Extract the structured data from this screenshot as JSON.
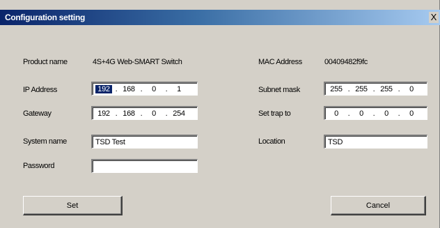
{
  "window": {
    "title": "Configuration setting",
    "close_glyph": "X"
  },
  "left": {
    "product_name_label": "Product name",
    "product_name_value": "4S+4G Web-SMART Switch",
    "ip_label": "IP Address",
    "ip": [
      "192",
      "168",
      "0",
      "1"
    ],
    "gateway_label": "Gateway",
    "gateway": [
      "192",
      "168",
      "0",
      "254"
    ],
    "system_name_label": "System name",
    "system_name": "TSD Test",
    "password_label": "Password",
    "password": ""
  },
  "right": {
    "mac_label": "MAC Address",
    "mac_value": "00409482f9fc",
    "subnet_label": "Subnet mask",
    "subnet": [
      "255",
      "255",
      "255",
      "0"
    ],
    "trap_label": "Set trap to",
    "trap": [
      "0",
      "0",
      "0",
      "0"
    ],
    "location_label": "Location",
    "location": "TSD"
  },
  "buttons": {
    "set": "Set",
    "cancel": "Cancel"
  },
  "colors": {
    "title_start": "#0a246a",
    "title_end": "#a6caf0",
    "face": "#d4d0c8"
  }
}
